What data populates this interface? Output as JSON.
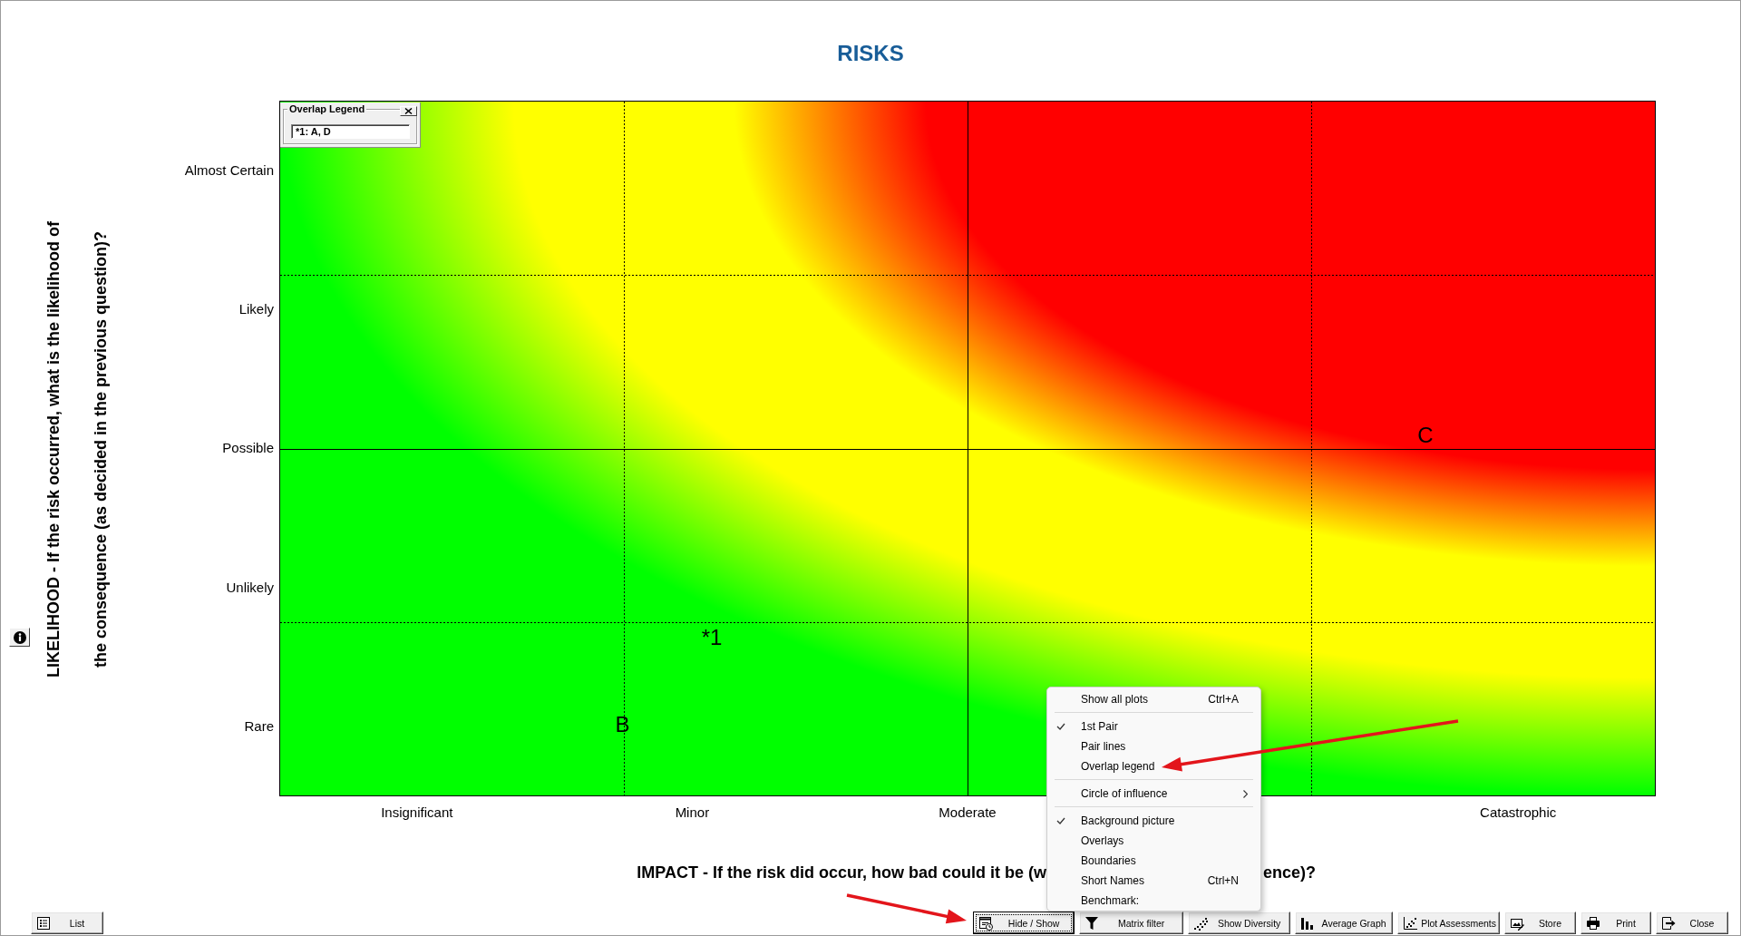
{
  "title": "RISKS",
  "risk_matrix": {
    "y_axis_title": "LIKELIHOOD - If the risk occurred, what is the likelihood of the consequence (as decided in the previous question)?",
    "y_labels": [
      "Almost Certain",
      "Likely",
      "Possible",
      "Unlikely",
      "Rare"
    ],
    "plot_labels": [
      "C",
      "*1",
      "B"
    ],
    "overlap_legend": {
      "title": "Overlap Legend",
      "entries": [
        "*1: A, D"
      ]
    },
    "x_labels": [
      "Insignificant",
      "Minor",
      "Moderate",
      "Catastrophic"
    ],
    "x_axis_title_parts": [
      "IMPACT - If the risk did occur, how bad could it be (w",
      "ence)?"
    ]
  },
  "context_menu": {
    "groups": [
      [
        {
          "label": "Show all plots",
          "shortcut": "Ctrl+A",
          "checked": false,
          "kind": "command"
        }
      ],
      [
        {
          "label": "1st Pair",
          "checked": true,
          "kind": "command"
        },
        {
          "label": "Pair lines",
          "checked": false,
          "kind": "command"
        },
        {
          "label": "Overlap legend",
          "checked": false,
          "kind": "command"
        }
      ],
      [
        {
          "label": "Circle of influence",
          "checked": false,
          "kind": "submenu"
        }
      ],
      [
        {
          "label": "Background picture",
          "checked": true,
          "kind": "command"
        },
        {
          "label": "Overlays",
          "checked": false,
          "kind": "command"
        },
        {
          "label": "Boundaries",
          "checked": false,
          "kind": "command"
        },
        {
          "label": "Short Names",
          "shortcut": "Ctrl+N",
          "checked": false,
          "kind": "command"
        },
        {
          "label": "Benchmark:",
          "checked": false,
          "kind": "command"
        }
      ]
    ]
  },
  "list_button": {
    "label": "List"
  },
  "toolbar": [
    {
      "label": "Hide / Show",
      "kind": "visibility",
      "focused": true
    },
    {
      "label": "Matrix filter",
      "kind": "filter",
      "focused": false
    },
    {
      "label": "Show Diversity",
      "kind": "diversity",
      "focused": false
    },
    {
      "label": "Average Graph",
      "kind": "average",
      "focused": false
    },
    {
      "label": "Plot Assessments",
      "kind": "assessments",
      "focused": false
    },
    {
      "label": "Store",
      "kind": "store",
      "focused": false
    },
    {
      "label": "Print",
      "kind": "print",
      "focused": false
    },
    {
      "label": "Close",
      "kind": "close",
      "focused": false
    }
  ]
}
